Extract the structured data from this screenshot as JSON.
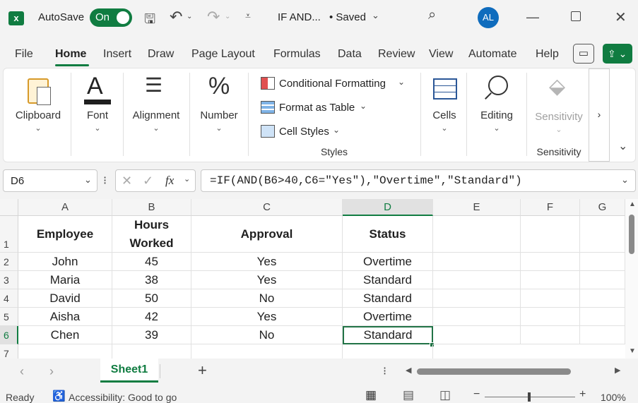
{
  "titlebar": {
    "autosave_label": "AutoSave",
    "autosave_state": "On",
    "file_name": "IF AND...",
    "saved_status": "• Saved",
    "avatar_initials": "AL"
  },
  "menu": [
    "File",
    "Home",
    "Insert",
    "Draw",
    "Page Layout",
    "Formulas",
    "Data",
    "Review",
    "View",
    "Automate",
    "Help"
  ],
  "ribbon": {
    "clipboard": "Clipboard",
    "font": "Font",
    "alignment": "Alignment",
    "number": "Number",
    "conditional_formatting": "Conditional Formatting",
    "format_as_table": "Format as Table",
    "cell_styles": "Cell Styles",
    "styles_group": "Styles",
    "cells": "Cells",
    "editing": "Editing",
    "sensitivity": "Sensitivity",
    "sensitivity_group": "Sensitivity"
  },
  "formula_bar": {
    "name_box": "D6",
    "fx": "fx",
    "formula": "=IF(AND(B6>40,C6=\"Yes\"),\"Overtime\",\"Standard\")"
  },
  "sheet": {
    "columns": [
      "A",
      "B",
      "C",
      "D",
      "E",
      "F",
      "G"
    ],
    "rows": [
      "1",
      "2",
      "3",
      "4",
      "5",
      "6",
      "7"
    ],
    "headers": {
      "a": "Employee",
      "b1": "Hours",
      "b2": "Worked",
      "c": "Approval",
      "d": "Status"
    },
    "data": [
      {
        "employee": "John",
        "hours": "45",
        "approval": "Yes",
        "status": "Overtime"
      },
      {
        "employee": "Maria",
        "hours": "38",
        "approval": "Yes",
        "status": "Standard"
      },
      {
        "employee": "David",
        "hours": "50",
        "approval": "No",
        "status": "Standard"
      },
      {
        "employee": "Aisha",
        "hours": "42",
        "approval": "Yes",
        "status": "Overtime"
      },
      {
        "employee": "Chen",
        "hours": "39",
        "approval": "No",
        "status": "Standard"
      }
    ]
  },
  "tabs": {
    "sheet1": "Sheet1",
    "add": "+"
  },
  "status": {
    "ready": "Ready",
    "accessibility": "Accessibility: Good to go",
    "zoom": "100%"
  },
  "colors": {
    "excel_green": "#107c41",
    "accent_blue": "#0f6cbd",
    "selection": "#217346"
  }
}
